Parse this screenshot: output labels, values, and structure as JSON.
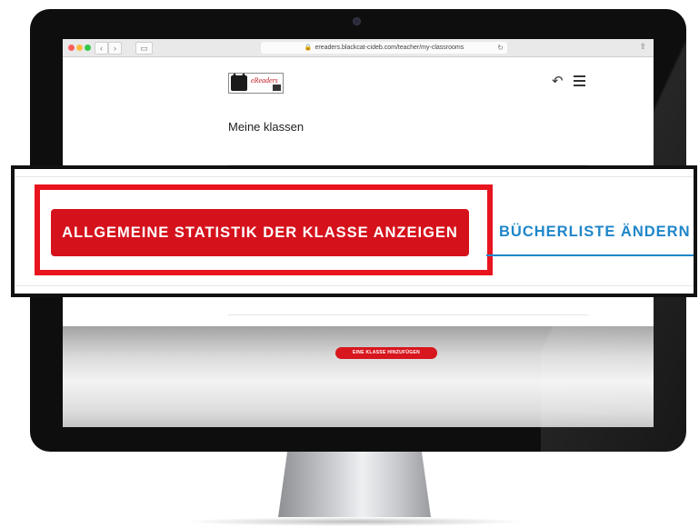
{
  "browser": {
    "url": "ereaders.blackcat-cideb.com/teacher/my-classrooms",
    "nav_back": "‹",
    "nav_forward": "›",
    "sidebar_toggle": "▭",
    "reload": "↻",
    "share": "⇪"
  },
  "header": {
    "logo_text": "eReaders",
    "back_glyph": "↶"
  },
  "page": {
    "title": "Meine klassen",
    "add_class_button": "EINE KLASSE HINZUFÜGEN"
  },
  "zoom_callout": {
    "stats_button": "ALLGEMEINE STATISTIK DER KLASSE ANZEIGEN",
    "booklist_button": "BÜCHERLISTE ÄNDERN"
  },
  "colors": {
    "brand_red": "#d5121c",
    "link_blue": "#1f86c9",
    "highlight_red": "#e8141e"
  }
}
